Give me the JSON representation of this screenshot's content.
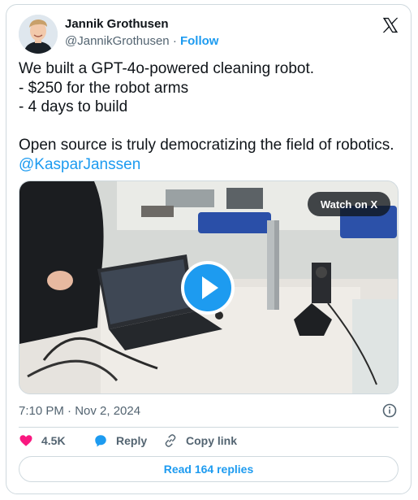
{
  "author": {
    "name": "Jannik Grothusen",
    "handle": "@JannikGrothusen",
    "separator": "·",
    "follow_label": "Follow",
    "avatar_icon": "profile-photo"
  },
  "brand": {
    "logo_icon": "x-logo-icon"
  },
  "tweet": {
    "lines": [
      "We built a GPT-4o-powered cleaning robot.",
      "- $250 for the robot arms",
      "- 4 days to build",
      "Open source is truly democratizing the field of robotics."
    ],
    "mention": "@KasparJanssen"
  },
  "media": {
    "watch_label": "Watch on X",
    "play_icon": "play-icon"
  },
  "meta": {
    "timestamp": "7:10 PM · Nov 2, 2024",
    "info_icon": "info-icon"
  },
  "actions": {
    "likes": "4.5K",
    "reply_label": "Reply",
    "copy_link_label": "Copy link",
    "icons": [
      "heart-icon",
      "reply-bubble-icon",
      "link-icon"
    ]
  },
  "read_replies_label": "Read 164 replies",
  "colors": {
    "accent": "#1d9bf0",
    "like": "#f91880",
    "muted": "#536471",
    "border": "#cfd9de"
  }
}
